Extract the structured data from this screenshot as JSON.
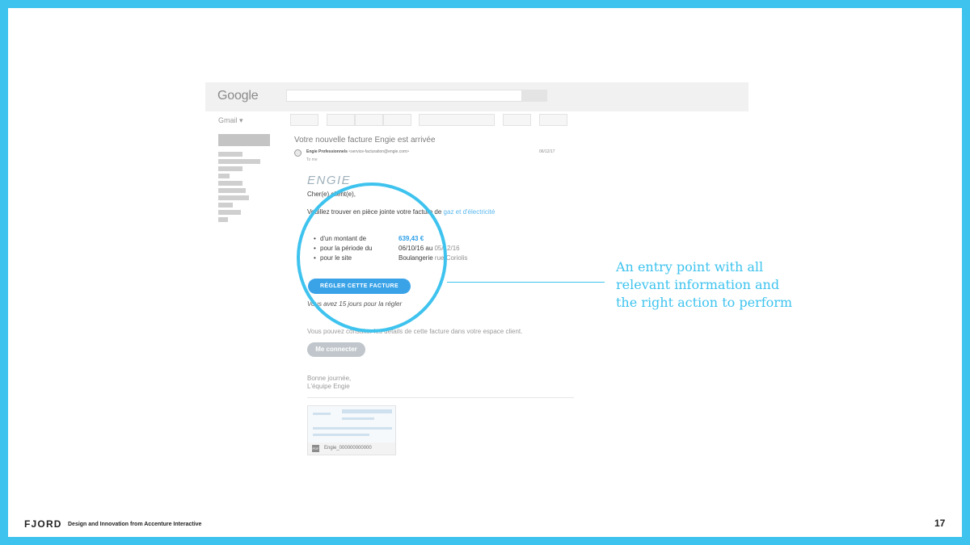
{
  "google": {
    "logo_text": "Google"
  },
  "gmail": {
    "label": "Gmail ▾"
  },
  "email": {
    "subject": "Votre nouvelle facture Engie est arrivée",
    "sender_name": "Engie Professionnels",
    "sender_address": "<service-facturation@engie.com>",
    "to": "To me",
    "date": "06/12/17",
    "brand_logo": "ENGIE",
    "greeting": "Cher(e) client(e),",
    "intro_text": "Veuillez trouver en pièce jointe votre facture de ",
    "intro_highlight": "gaz et d'électricité",
    "bullets": [
      {
        "label": "d'un montant de",
        "value": "639,43 €"
      },
      {
        "label": "pour la période du",
        "value_main": "06/10/16 au ",
        "value_faded": "05/12/16"
      },
      {
        "label": "pour le site",
        "value_main": "Boulangerie ",
        "value_faded": "rue Coriolis"
      }
    ],
    "pay_button": "RÉGLER CETTE FACTURE",
    "deadline": "Vous avez 15 jours pour la régler",
    "details_text": "Vous pouvez consulter les détails de cette facture dans votre espace client.",
    "login_button": "Me connecter",
    "sign_line1": "Bonne journée,",
    "sign_line2": "L'équipe Engie",
    "attachment": {
      "type": "PDF",
      "name": "Engie_000000000000"
    }
  },
  "annotation": {
    "text": "An entry point with all relevant information and the right action to perform"
  },
  "footer": {
    "logo": "FJORD",
    "tagline": "Design and Innovation from Accenture Interactive",
    "page_number": "17"
  },
  "colors": {
    "accent": "#3ec3ee",
    "button_primary": "#3aa3e8",
    "amount": "#2b9ee8"
  }
}
